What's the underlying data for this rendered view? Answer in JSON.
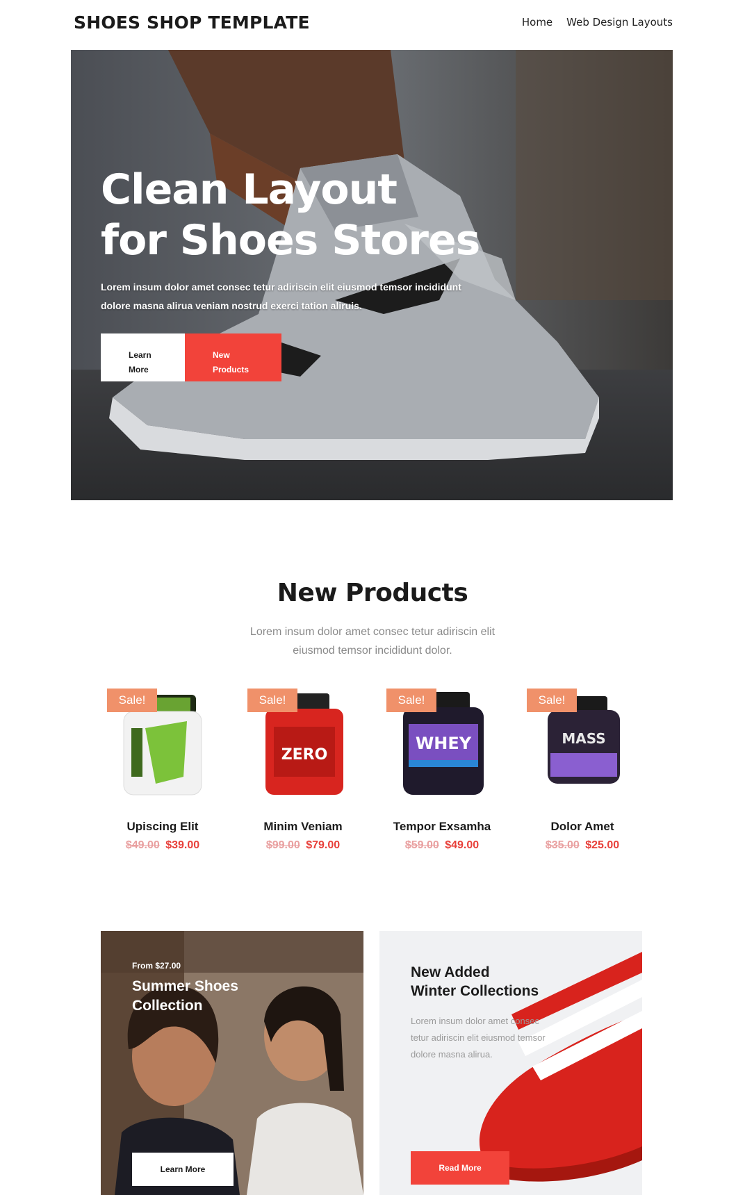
{
  "header": {
    "brand": "SHOES SHOP TEMPLATE",
    "nav": [
      "Home",
      "Web Design Layouts"
    ]
  },
  "hero": {
    "title_line1": "Clean Layout",
    "title_line2": "for Shoes Stores",
    "text": "Lorem insum dolor amet consec tetur adiriscin elit eiusmod temsor incididunt dolore masna alirua veniam nostrud exerci tation aliruis.",
    "btn_learn_line1": "Learn",
    "btn_learn_line2": "More",
    "btn_new_line1": "New",
    "btn_new_line2": "Products"
  },
  "products_section": {
    "title": "New Products",
    "subtitle": "Lorem insum dolor amet consec tetur adiriscin elit eiusmod temsor incididunt dolor.",
    "items": [
      {
        "badge": "Sale!",
        "name": "Upiscing Elit",
        "old_price": "$49.00",
        "price": "$39.00",
        "color": "#7cc23a"
      },
      {
        "badge": "Sale!",
        "name": "Minim Veniam",
        "old_price": "$99.00",
        "price": "$79.00",
        "color": "#d8251f"
      },
      {
        "badge": "Sale!",
        "name": "Tempor Exsamha",
        "old_price": "$59.00",
        "price": "$49.00",
        "color": "#2a1f3d"
      },
      {
        "badge": "Sale!",
        "name": "Dolor Amet",
        "old_price": "$35.00",
        "price": "$25.00",
        "color": "#3d2b4f"
      }
    ]
  },
  "promo_left": {
    "from": "From $27.00",
    "title_line1": "Summer Shoes",
    "title_line2": "Collection",
    "button": "Learn More"
  },
  "promo_right": {
    "title_line1": "New Added",
    "title_line2": "Winter Collections",
    "text": "Lorem insum dolor amet consec tetur adiriscin elit eiusmod temsor dolore masna alirua.",
    "button": "Read More"
  },
  "colors": {
    "accent": "#f2433a",
    "sale_badge": "#f0916a",
    "price": "#e8403a"
  }
}
